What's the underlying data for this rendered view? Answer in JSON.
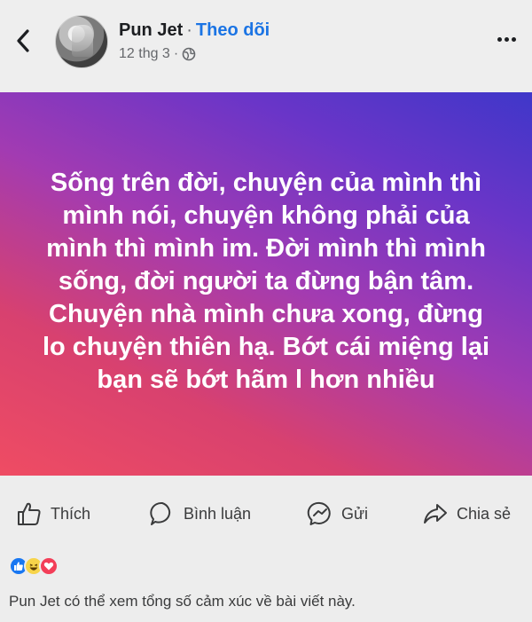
{
  "header": {
    "author_name": "Pun Jet",
    "separator": "·",
    "follow_label": "Theo dõi",
    "post_date": "12 thg 3",
    "meta_separator": "·",
    "back_icon": "chevron-left-icon",
    "audience_icon": "globe-icon",
    "more_icon": "more-horizontal-icon"
  },
  "post": {
    "text": "Sống trên đời, chuyện của mình thì mình nói, chuyện không phải của mình thì mình im. Đời mình thì mình sống, đời người ta đừng bận tâm. Chuyện nhà mình chưa xong, đừng lo chuyện thiên hạ. Bớt cái miệng lại bạn sẽ bớt hãm l hơn nhiều",
    "background_colors": [
      "#3f37c9",
      "#a23bb2",
      "#ef4c63"
    ]
  },
  "actions": {
    "like_label": "Thích",
    "comment_label": "Bình luận",
    "send_label": "Gửi",
    "share_label": "Chia sẻ"
  },
  "reactions": {
    "icons": [
      "like-reaction-icon",
      "haha-reaction-icon",
      "love-reaction-icon"
    ],
    "note": "Pun Jet có thể xem tổng số cảm xúc về bài viết này."
  },
  "colors": {
    "accent": "#1b74e4",
    "text": "#1c1e21",
    "muted": "#65676b"
  }
}
